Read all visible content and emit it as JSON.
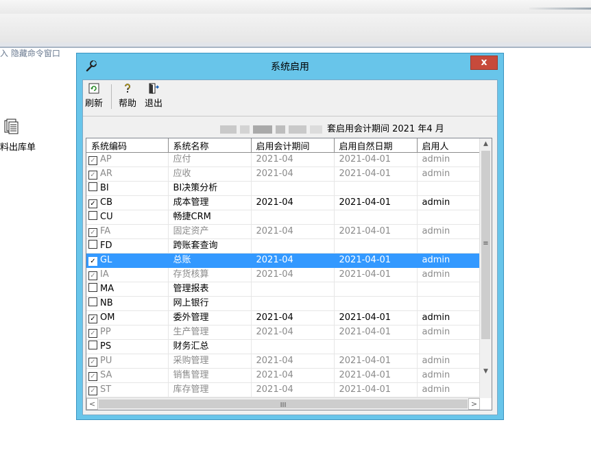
{
  "background": {
    "command_text": "入 隐藏命令窗口",
    "desktop_item_label": "料出库单"
  },
  "dialog": {
    "title": "系统启用",
    "close_label": "x",
    "toolbar": {
      "refresh_label": "刷新",
      "help_label": "帮助",
      "exit_label": "退出"
    },
    "period_text": "套启用会计期间 2021 年4 月",
    "columns": [
      "系统编码",
      "系统名称",
      "启用会计期间",
      "启用自然日期",
      "启用人"
    ],
    "rows": [
      {
        "checked": true,
        "code": "AP",
        "name": "应付",
        "period": "2021-04",
        "date": "2021-04-01",
        "user": "admin",
        "style": "grey"
      },
      {
        "checked": true,
        "code": "AR",
        "name": "应收",
        "period": "2021-04",
        "date": "2021-04-01",
        "user": "admin",
        "style": "grey"
      },
      {
        "checked": false,
        "code": "BI",
        "name": "BI决策分析",
        "period": "",
        "date": "",
        "user": "",
        "style": "normal"
      },
      {
        "checked": true,
        "code": "CB",
        "name": "成本管理",
        "period": "2021-04",
        "date": "2021-04-01",
        "user": "admin",
        "style": "normal"
      },
      {
        "checked": false,
        "code": "CU",
        "name": "畅捷CRM",
        "period": "",
        "date": "",
        "user": "",
        "style": "normal"
      },
      {
        "checked": true,
        "code": "FA",
        "name": "固定资产",
        "period": "2021-04",
        "date": "2021-04-01",
        "user": "admin",
        "style": "grey"
      },
      {
        "checked": false,
        "code": "FD",
        "name": "跨账套查询",
        "period": "",
        "date": "",
        "user": "",
        "style": "normal"
      },
      {
        "checked": true,
        "code": "GL",
        "name": "总账",
        "period": "2021-04",
        "date": "2021-04-01",
        "user": "admin",
        "style": "selected"
      },
      {
        "checked": true,
        "code": "IA",
        "name": "存货核算",
        "period": "2021-04",
        "date": "2021-04-01",
        "user": "admin",
        "style": "grey"
      },
      {
        "checked": false,
        "code": "MA",
        "name": "管理报表",
        "period": "",
        "date": "",
        "user": "",
        "style": "normal"
      },
      {
        "checked": false,
        "code": "NB",
        "name": "网上银行",
        "period": "",
        "date": "",
        "user": "",
        "style": "normal"
      },
      {
        "checked": true,
        "code": "OM",
        "name": "委外管理",
        "period": "2021-04",
        "date": "2021-04-01",
        "user": "admin",
        "style": "normal"
      },
      {
        "checked": true,
        "code": "PP",
        "name": "生产管理",
        "period": "2021-04",
        "date": "2021-04-01",
        "user": "admin",
        "style": "grey"
      },
      {
        "checked": false,
        "code": "PS",
        "name": "财务汇总",
        "period": "",
        "date": "",
        "user": "",
        "style": "normal"
      },
      {
        "checked": true,
        "code": "PU",
        "name": "采购管理",
        "period": "2021-04",
        "date": "2021-04-01",
        "user": "admin",
        "style": "grey"
      },
      {
        "checked": true,
        "code": "SA",
        "name": "销售管理",
        "period": "2021-04",
        "date": "2021-04-01",
        "user": "admin",
        "style": "grey"
      },
      {
        "checked": true,
        "code": "ST",
        "name": "库存管理",
        "period": "2021-04",
        "date": "2021-04-01",
        "user": "admin",
        "style": "grey"
      }
    ],
    "scroll_grip": "≡",
    "hscroll_grip": "III"
  },
  "colors": {
    "dialog_frame": "#68c5ea",
    "selection": "#3399ff",
    "close_button": "#c74a3b",
    "disabled_text": "#8a8a8a"
  }
}
